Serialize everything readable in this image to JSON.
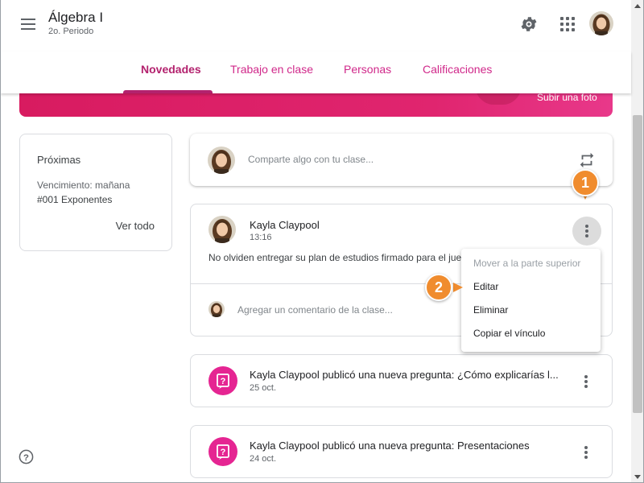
{
  "header": {
    "class_name": "Álgebra I",
    "class_section": "2o. Periodo",
    "icons": {
      "menu": "hamburger-icon",
      "settings": "gear-icon",
      "apps": "apps-grid-icon",
      "account": "avatar"
    }
  },
  "tabs": [
    {
      "label": "Novedades",
      "active": true
    },
    {
      "label": "Trabajo en clase",
      "active": false
    },
    {
      "label": "Personas",
      "active": false
    },
    {
      "label": "Calificaciones",
      "active": false
    }
  ],
  "banner": {
    "upload_label": "Subir una foto"
  },
  "upcoming": {
    "title": "Próximas",
    "due": "Vencimiento: mañana",
    "item": "#001 Exponentes",
    "view_all": "Ver todo"
  },
  "share": {
    "placeholder": "Comparte algo con tu clase..."
  },
  "post": {
    "author": "Kayla Claypool",
    "time": "13:16",
    "text": "No olviden entregar su plan de estudios firmado para el jueves",
    "comment_placeholder": "Agregar un comentario de la clase..."
  },
  "post_menu": {
    "items": [
      {
        "label": "Mover a la parte superior",
        "disabled": true
      },
      {
        "label": "Editar",
        "disabled": false
      },
      {
        "label": "Eliminar",
        "disabled": false
      },
      {
        "label": "Copiar el vínculo",
        "disabled": false
      }
    ]
  },
  "questions": [
    {
      "title": "Kayla Claypool publicó una nueva pregunta: ¿Cómo explicarías l...",
      "date": "25 oct."
    },
    {
      "title": "Kayla Claypool publicó una nueva pregunta: Presentaciones",
      "date": "24 oct."
    }
  ],
  "callouts": [
    "1",
    "2"
  ],
  "colors": {
    "accent": "#b3226e",
    "tab": "#d0288a",
    "banner": "#d81b60",
    "callout": "#f08c2e",
    "question_icon": "#e52592"
  }
}
